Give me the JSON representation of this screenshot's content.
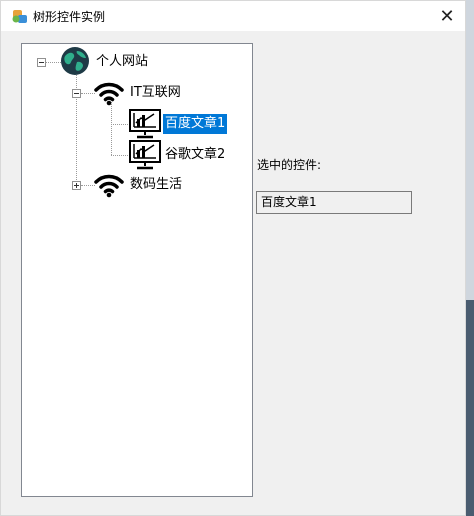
{
  "window": {
    "title": "树形控件实例",
    "close_glyph": "✕"
  },
  "tree": {
    "root": {
      "label": "个人网站",
      "toggle": "expanded",
      "icon": "globe-icon"
    },
    "group1": {
      "label": "IT互联网",
      "toggle": "expanded",
      "icon": "wifi-icon"
    },
    "child1": {
      "label": "百度文章1",
      "icon": "monitor-chart-icon",
      "selected": true
    },
    "child2": {
      "label": "谷歌文章2",
      "icon": "monitor-chart-icon"
    },
    "group2": {
      "label": "数码生活",
      "toggle": "collapsed",
      "icon": "wifi-icon"
    }
  },
  "selection": {
    "caption": "选中的控件:",
    "value": "百度文章1"
  },
  "colors": {
    "selected_bg": "#0078d7",
    "window_bg": "#f0f0f0"
  }
}
